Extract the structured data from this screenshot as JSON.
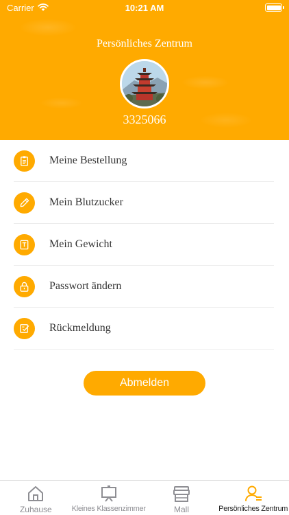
{
  "status_bar": {
    "carrier": "Carrier",
    "time": "10:21 AM"
  },
  "header": {
    "title": "Persönliches Zentrum",
    "user_id": "3325066"
  },
  "menu": {
    "items": [
      {
        "label": "Meine Bestellung",
        "icon": "clipboard-icon"
      },
      {
        "label": "Mein Blutzucker",
        "icon": "pen-icon"
      },
      {
        "label": "Mein Gewicht",
        "icon": "scale-icon"
      },
      {
        "label": "Passwort ändern",
        "icon": "lock-icon"
      },
      {
        "label": "Rückmeldung",
        "icon": "feedback-icon"
      }
    ]
  },
  "logout": {
    "label": "Abmelden"
  },
  "tab_bar": {
    "tabs": [
      {
        "label": "Zuhause",
        "icon": "home-icon"
      },
      {
        "label": "Kleines Klassenzimmer",
        "icon": "classroom-icon"
      },
      {
        "label": "Mall",
        "icon": "shop-icon"
      },
      {
        "label": "Persönliches Zentrum",
        "icon": "person-icon",
        "active": true
      }
    ]
  },
  "colors": {
    "accent": "#FFAA00",
    "tab_inactive": "#8e8e93",
    "tab_active_icon": "#FFAA00"
  }
}
